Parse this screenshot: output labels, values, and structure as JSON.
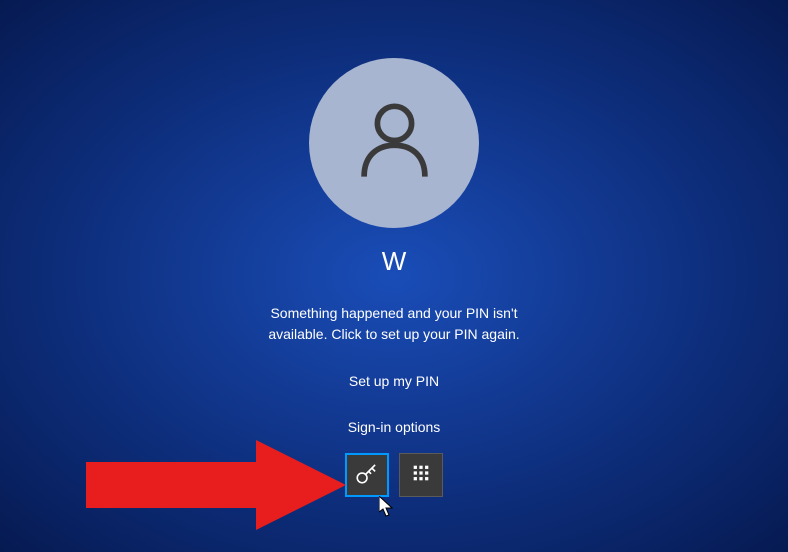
{
  "user": {
    "name": "W",
    "avatar_icon": "person-icon"
  },
  "error": {
    "line1": "Something happened and your PIN isn't",
    "line2": "available. Click to set up your PIN again."
  },
  "actions": {
    "setup_pin": "Set up my PIN",
    "signin_options": "Sign-in options"
  },
  "signin_methods": [
    {
      "id": "password",
      "icon": "key-icon",
      "active": true
    },
    {
      "id": "pin",
      "icon": "pin-pad-icon",
      "active": false
    }
  ],
  "annotation": {
    "arrow_color": "#e81e1e"
  }
}
